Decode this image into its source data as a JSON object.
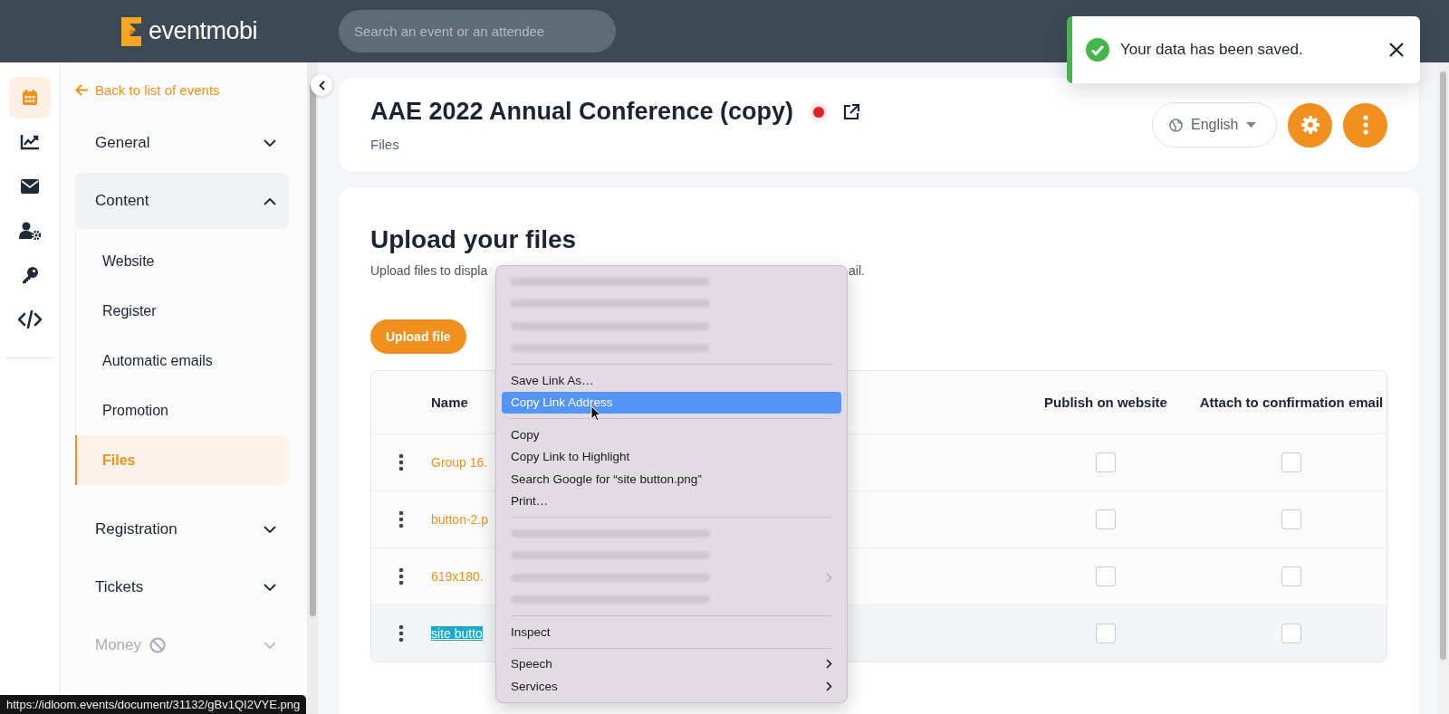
{
  "header": {
    "logo_text": "eventmobi",
    "search": {
      "placeholder": "Search an event or an attendee"
    }
  },
  "rail_icons": [
    {
      "kind": "calendar",
      "selected": true
    },
    {
      "kind": "chart",
      "selected": false
    },
    {
      "kind": "mail",
      "selected": false
    },
    {
      "kind": "user-gear",
      "selected": false
    },
    {
      "kind": "key",
      "selected": false
    },
    {
      "kind": "code",
      "selected": false
    }
  ],
  "sidebar": {
    "back_link": "Back to list of events",
    "items": [
      {
        "label": "General",
        "expanded": false,
        "disabled": false
      },
      {
        "label": "Content",
        "expanded": true,
        "disabled": false,
        "children": [
          {
            "label": "Website",
            "selected": false
          },
          {
            "label": "Register",
            "selected": false
          },
          {
            "label": "Automatic emails",
            "selected": false
          },
          {
            "label": "Promotion",
            "selected": false
          },
          {
            "label": "Files",
            "selected": true
          }
        ]
      },
      {
        "label": "Registration",
        "expanded": false,
        "disabled": false
      },
      {
        "label": "Tickets",
        "expanded": false,
        "disabled": false
      },
      {
        "label": "Money",
        "expanded": false,
        "disabled": true
      }
    ]
  },
  "event": {
    "title": "AAE 2022 Annual Conference (copy)",
    "breadcrumb": "Files",
    "language": "English"
  },
  "files": {
    "title": "Upload your files",
    "description_start": "Upload files to displa",
    "description_end": "ail.",
    "upload_button": "Upload file",
    "table": {
      "columns": [
        "Name",
        "Publish on website",
        "Attach to confirmation email"
      ],
      "rows": [
        {
          "name": "Group 16.",
          "publish": false,
          "attach": false,
          "highlighted": false
        },
        {
          "name": "button-2.p",
          "publish": false,
          "attach": false,
          "highlighted": false
        },
        {
          "name": "619x180.",
          "publish": false,
          "attach": false,
          "highlighted": false
        },
        {
          "name": "site butto",
          "publish": false,
          "attach": false,
          "highlighted": true
        }
      ]
    }
  },
  "context_menu": {
    "items": [
      {
        "kind": "redacted",
        "submenu": false
      },
      {
        "kind": "redacted",
        "submenu": false
      },
      {
        "kind": "redacted",
        "submenu": false
      },
      {
        "kind": "redacted",
        "submenu": false
      },
      {
        "kind": "separator"
      },
      {
        "kind": "item",
        "label": "Save Link As…",
        "selected": false,
        "submenu": false
      },
      {
        "kind": "item",
        "label": "Copy Link Address",
        "selected": true,
        "submenu": false
      },
      {
        "kind": "separator"
      },
      {
        "kind": "item",
        "label": "Copy",
        "selected": false,
        "submenu": false
      },
      {
        "kind": "item",
        "label": "Copy Link to Highlight",
        "selected": false,
        "submenu": false
      },
      {
        "kind": "item",
        "label": "Search Google for “site button.png”",
        "selected": false,
        "submenu": false
      },
      {
        "kind": "item",
        "label": "Print…",
        "selected": false,
        "submenu": false
      },
      {
        "kind": "separator"
      },
      {
        "kind": "redacted",
        "submenu": false
      },
      {
        "kind": "redacted",
        "submenu": false
      },
      {
        "kind": "redacted",
        "submenu": true
      },
      {
        "kind": "redacted",
        "submenu": false
      },
      {
        "kind": "separator"
      },
      {
        "kind": "item",
        "label": "Inspect",
        "selected": false,
        "submenu": false
      },
      {
        "kind": "separator"
      },
      {
        "kind": "item",
        "label": "Speech",
        "selected": false,
        "submenu": true
      },
      {
        "kind": "item",
        "label": "Services",
        "selected": false,
        "submenu": true
      }
    ]
  },
  "toast": {
    "message": "Your data has been saved."
  },
  "status_url": "https://idloom.events/document/31132/gBv1QI2VYE.png"
}
